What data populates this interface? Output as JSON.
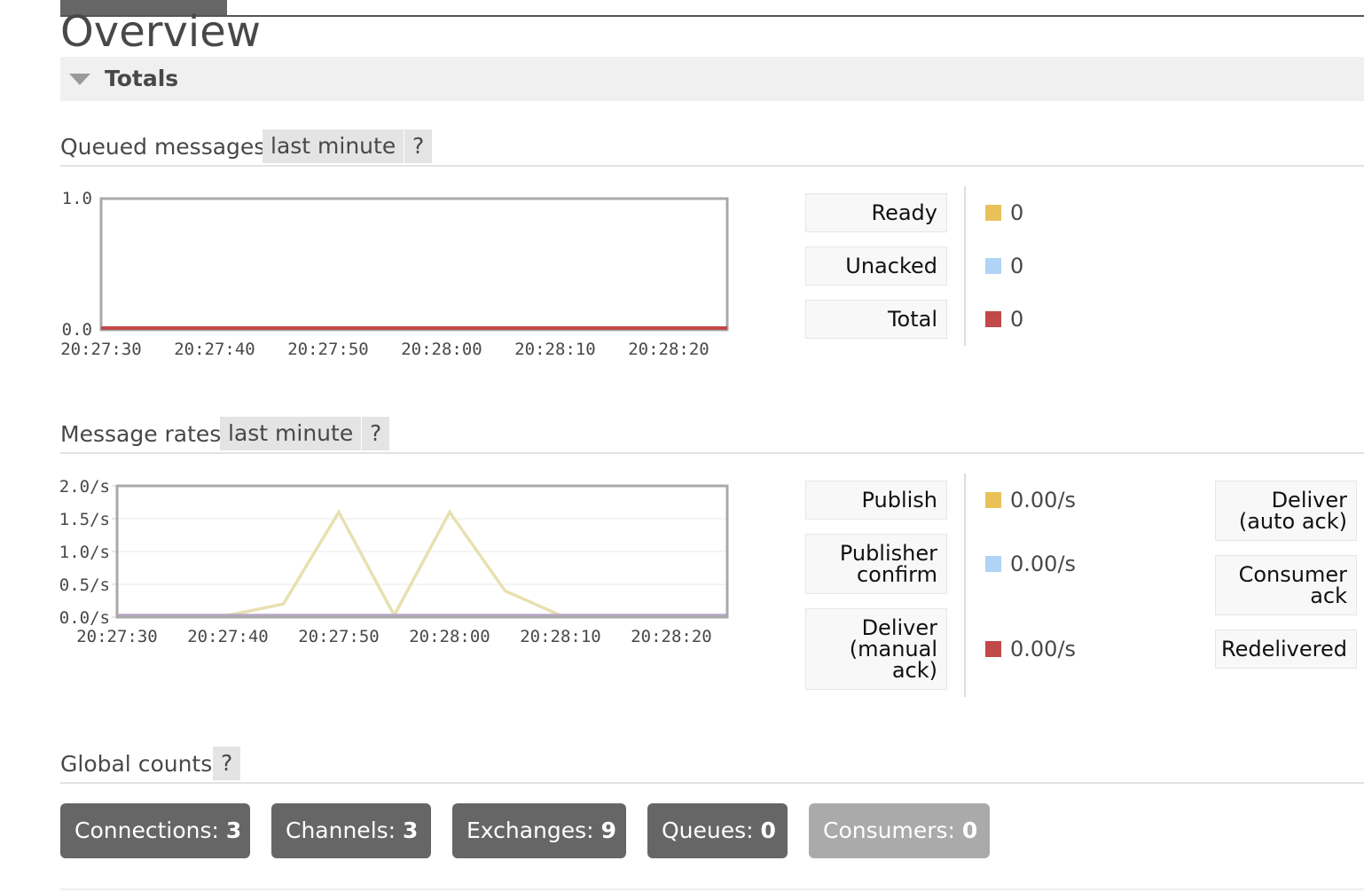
{
  "page": {
    "title": "Overview"
  },
  "totals": {
    "label": "Totals"
  },
  "queued": {
    "title": "Queued messages",
    "range": "last minute",
    "help": "?",
    "legend": [
      {
        "label": "Ready",
        "value": "0",
        "color": "#e8c259"
      },
      {
        "label": "Unacked",
        "value": "0",
        "color": "#afd4f5"
      },
      {
        "label": "Total",
        "value": "0",
        "color": "#c24949"
      }
    ]
  },
  "rates": {
    "title": "Message rates",
    "range": "last minute",
    "help": "?",
    "legend_left": [
      {
        "label_lines": [
          "Publish"
        ],
        "value": "0.00/s",
        "color": "#e8c259"
      },
      {
        "label_lines": [
          "Publisher",
          "confirm"
        ],
        "value": "0.00/s",
        "color": "#afd4f5"
      },
      {
        "label_lines": [
          "Deliver",
          "(manual",
          "ack)"
        ],
        "value": "0.00/s",
        "color": "#c24949"
      }
    ],
    "legend_right": [
      {
        "label_lines": [
          "Deliver",
          "(auto ack)"
        ]
      },
      {
        "label_lines": [
          "Consumer",
          "ack"
        ]
      },
      {
        "label_lines": [
          "Redelivered"
        ]
      }
    ]
  },
  "global": {
    "title": "Global counts",
    "help": "?",
    "counts": [
      {
        "label": "Connections:",
        "value": "3",
        "faded": false
      },
      {
        "label": "Channels:",
        "value": "3",
        "faded": false
      },
      {
        "label": "Exchanges:",
        "value": "9",
        "faded": false
      },
      {
        "label": "Queues:",
        "value": "0",
        "faded": false
      },
      {
        "label": "Consumers:",
        "value": "0",
        "faded": true
      }
    ]
  },
  "chart_data": [
    {
      "type": "line",
      "x": [
        "20:27:30",
        "20:27:40",
        "20:27:50",
        "20:28:00",
        "20:28:10",
        "20:28:20",
        "20:28:25"
      ],
      "series": [
        {
          "name": "Ready",
          "color": "#e8c259",
          "values": [
            0,
            0,
            0,
            0,
            0,
            0,
            0
          ]
        },
        {
          "name": "Unacked",
          "color": "#afd4f5",
          "values": [
            0,
            0,
            0,
            0,
            0,
            0,
            0
          ]
        },
        {
          "name": "Total",
          "color": "#c24949",
          "values": [
            0,
            0,
            0,
            0,
            0,
            0,
            0
          ]
        }
      ],
      "xticks": [
        "20:27:30",
        "20:27:40",
        "20:27:50",
        "20:28:00",
        "20:28:10",
        "20:28:20"
      ],
      "yticks": [
        "0.0",
        "1.0"
      ],
      "ylim": [
        0,
        1
      ],
      "grid": false
    },
    {
      "type": "line",
      "x_seconds": [
        0,
        10,
        15,
        20,
        25,
        30,
        35,
        40,
        45,
        55
      ],
      "series": [
        {
          "name": "Publish",
          "color": "#e8e0b0",
          "values": [
            0,
            0,
            0.2,
            1.6,
            0,
            1.6,
            0.4,
            0,
            0,
            0
          ]
        },
        {
          "name": "Deliver (manual ack)",
          "color": "#b8a5c8",
          "values": [
            0,
            0,
            0,
            0,
            0,
            0,
            0,
            0,
            0,
            0
          ]
        }
      ],
      "xticks": [
        "20:27:30",
        "20:27:40",
        "20:27:50",
        "20:28:00",
        "20:28:10",
        "20:28:20"
      ],
      "yticks": [
        "0.0/s",
        "0.5/s",
        "1.0/s",
        "1.5/s",
        "2.0/s"
      ],
      "ylim": [
        0,
        2
      ],
      "grid": true
    }
  ]
}
